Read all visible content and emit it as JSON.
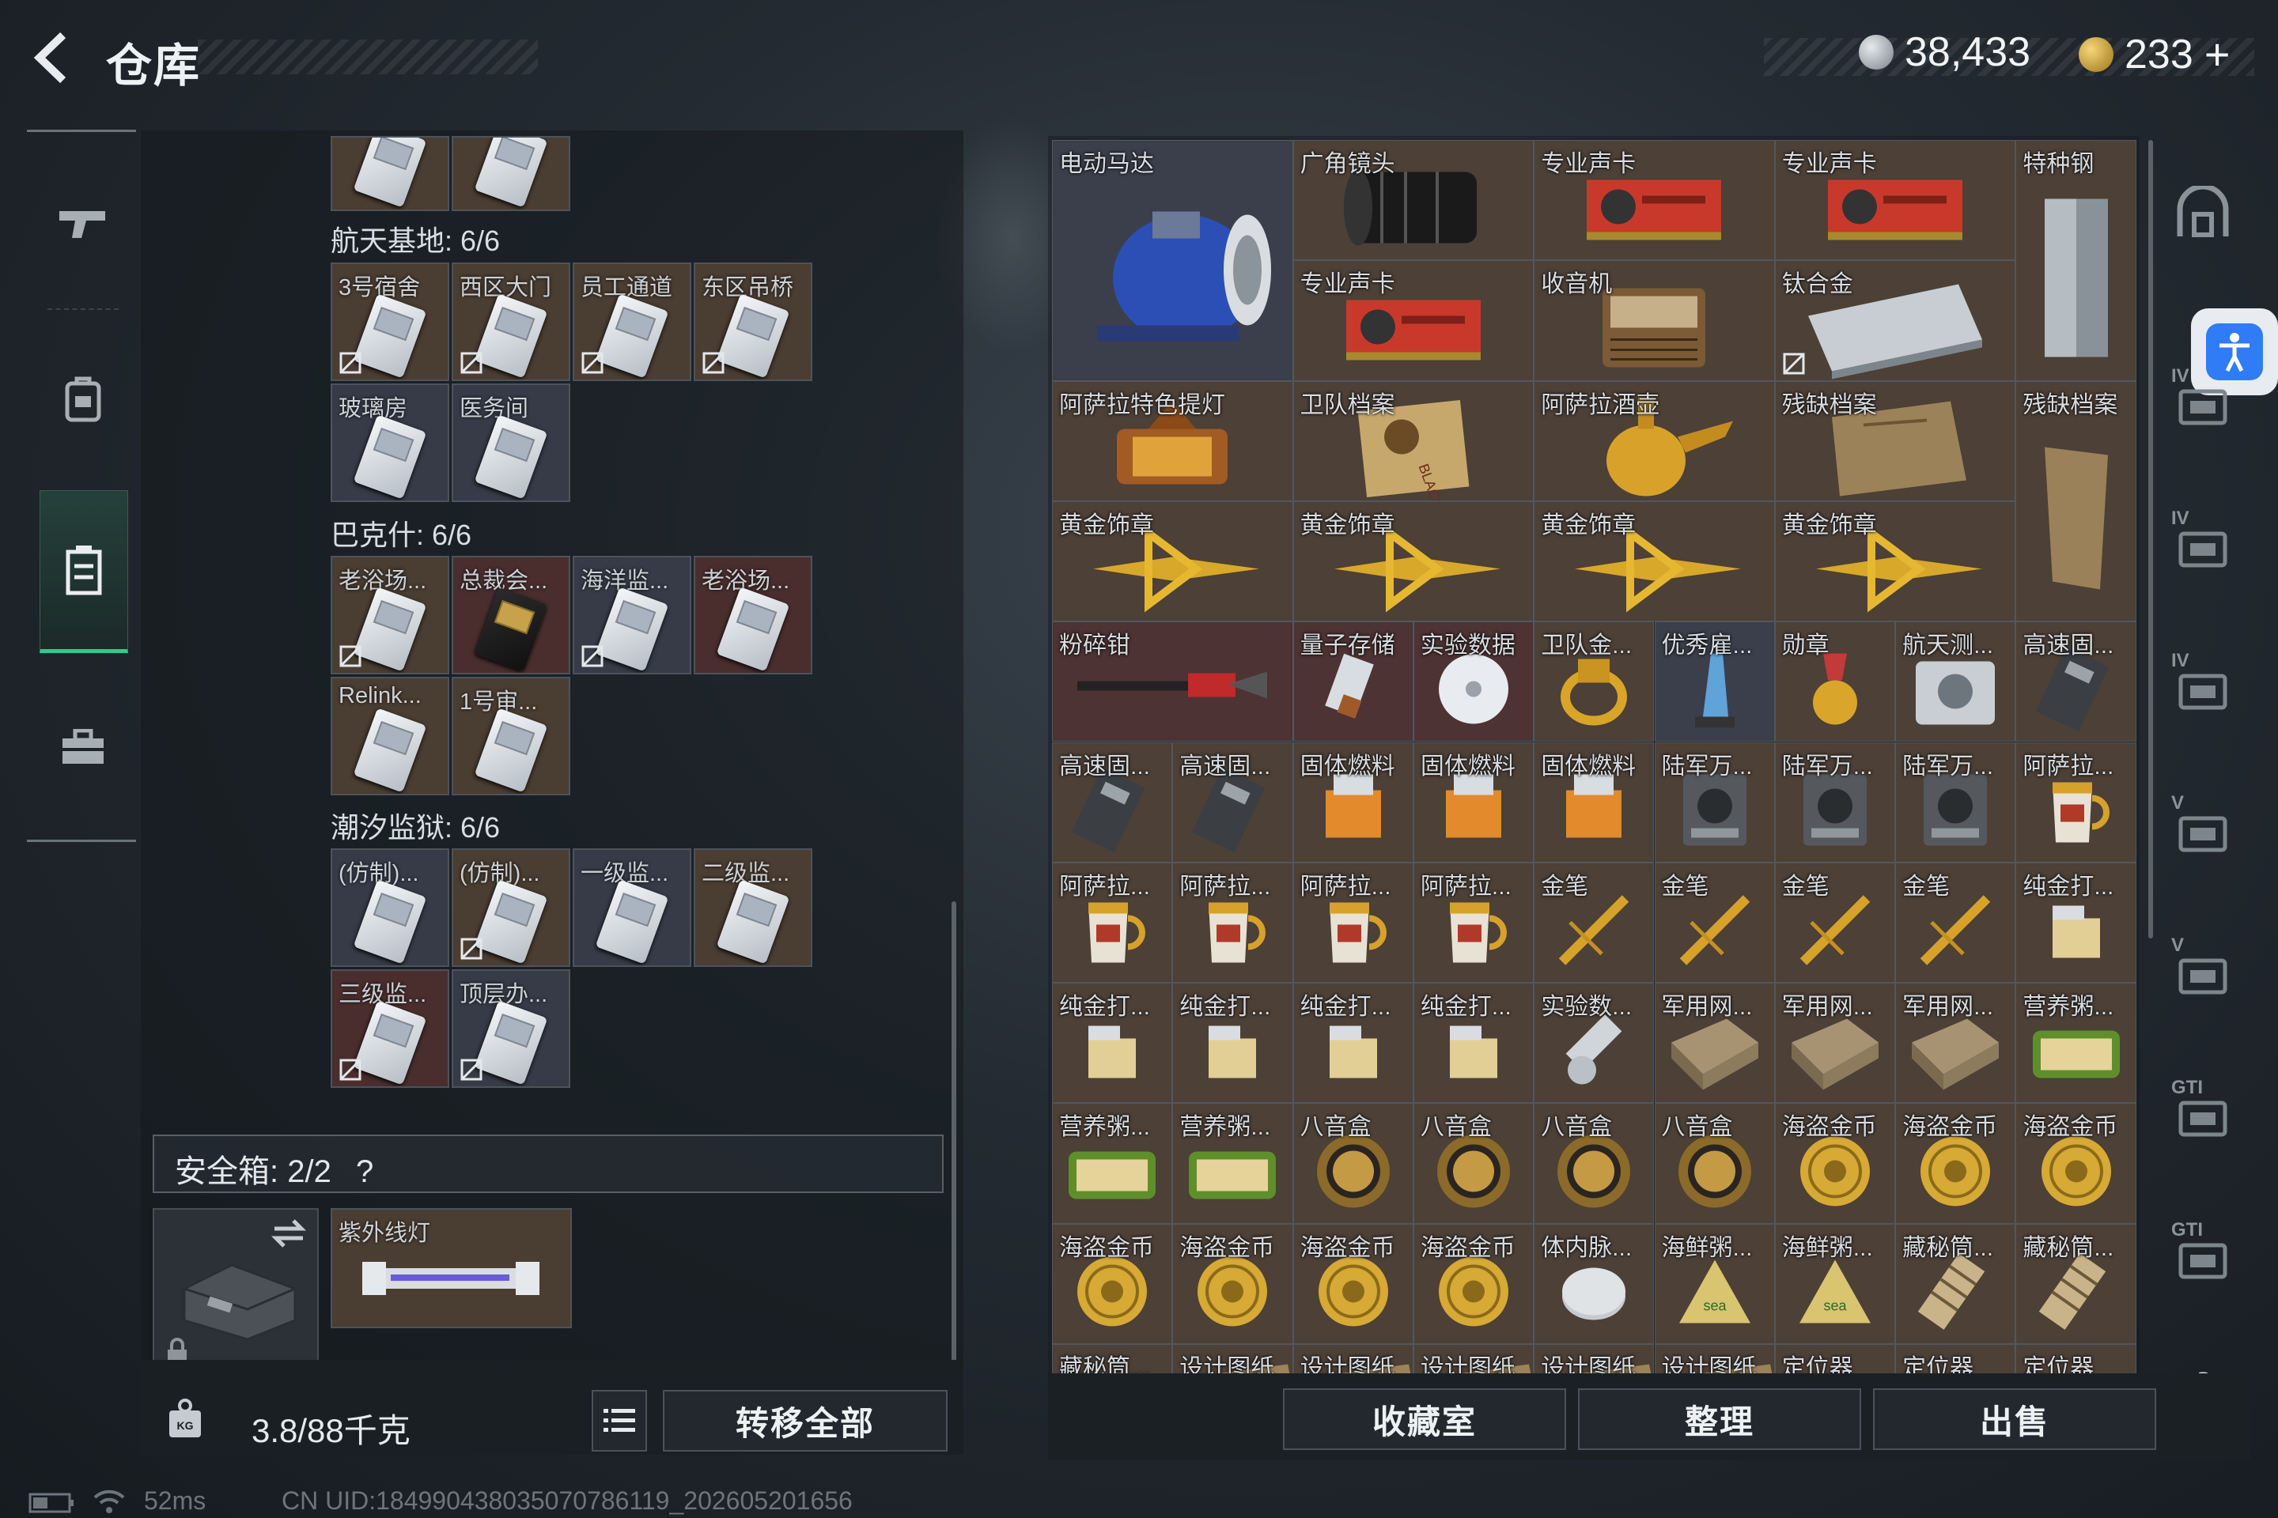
{
  "header": {
    "title": "仓库",
    "currency1": "38,433",
    "currency2": "233"
  },
  "sections": [
    {
      "name": "航天基地: 6/6",
      "keys": [
        "3号宿舍",
        "西区大门",
        "员工通道",
        "东区吊桥",
        "玻璃房",
        "医务间"
      ]
    },
    {
      "name": "巴克什: 6/6",
      "keys": [
        "老浴场...",
        "总裁会...",
        "海洋监...",
        "老浴场...",
        "Relink...",
        "1号审..."
      ]
    },
    {
      "name": "潮汐监狱: 6/6",
      "keys": [
        "(仿制)...",
        "(仿制)...",
        "一级监...",
        "二级监...",
        "三级监...",
        "顶层办..."
      ]
    }
  ],
  "safebox": {
    "label": "安全箱: 2/2",
    "help": "?",
    "item": "紫外线灯"
  },
  "capacity": {
    "value": "3.8/88千克"
  },
  "buttons": {
    "transfer_all": "转移全部",
    "collection": "收藏室",
    "sort": "整理",
    "sell": "出售"
  },
  "grid": {
    "big": [
      "电动马达",
      "广角镜头",
      "专业声卡",
      "专业声卡",
      "特种钢",
      "专业声卡",
      "收音机",
      "钛合金",
      "阿萨拉特色提灯",
      "卫队档案",
      "阿萨拉酒壶",
      "残缺档案",
      "残缺档案",
      "黄金饰章",
      "黄金饰章",
      "黄金饰章",
      "黄金饰章",
      "粉碎钳"
    ],
    "small": [
      "量子存储",
      "实验数据",
      "卫队金...",
      "优秀雇...",
      "勋章",
      "航天测...",
      "高速固...",
      "高速固...",
      "高速固...",
      "固体燃料",
      "固体燃料",
      "固体燃料",
      "陆军万...",
      "陆军万...",
      "陆军万...",
      "阿萨拉...",
      "阿萨拉...",
      "阿萨拉...",
      "阿萨拉...",
      "阿萨拉...",
      "金笔",
      "金笔",
      "金笔",
      "金笔",
      "纯金打...",
      "纯金打...",
      "纯金打...",
      "纯金打...",
      "纯金打...",
      "实验数...",
      "军用网...",
      "军用网...",
      "军用网...",
      "营养粥...",
      "营养粥...",
      "营养粥...",
      "八音盒",
      "八音盒",
      "八音盒",
      "八音盒",
      "海盗金币",
      "海盗金币",
      "海盗金币",
      "海盗金币",
      "海盗金币",
      "海盗金币",
      "海盗金币",
      "体内脉...",
      "海鲜粥...",
      "海鲜粥...",
      "藏秘筒...",
      "藏秘筒...",
      "藏秘筒...",
      "设计图纸",
      "设计图纸",
      "设计图纸",
      "设计图纸",
      "设计图纸",
      "定位器",
      "定位器",
      "定位器"
    ]
  },
  "right_side": [
    "IV",
    "IV",
    "IV",
    "V",
    "V",
    "GTI",
    "GTI"
  ],
  "status": {
    "ping": "52ms",
    "uid": "CN UID:184990438035070786119_202605201656"
  },
  "colors": {
    "accent_green": "#33c98b",
    "gold": "#d8a42a"
  }
}
